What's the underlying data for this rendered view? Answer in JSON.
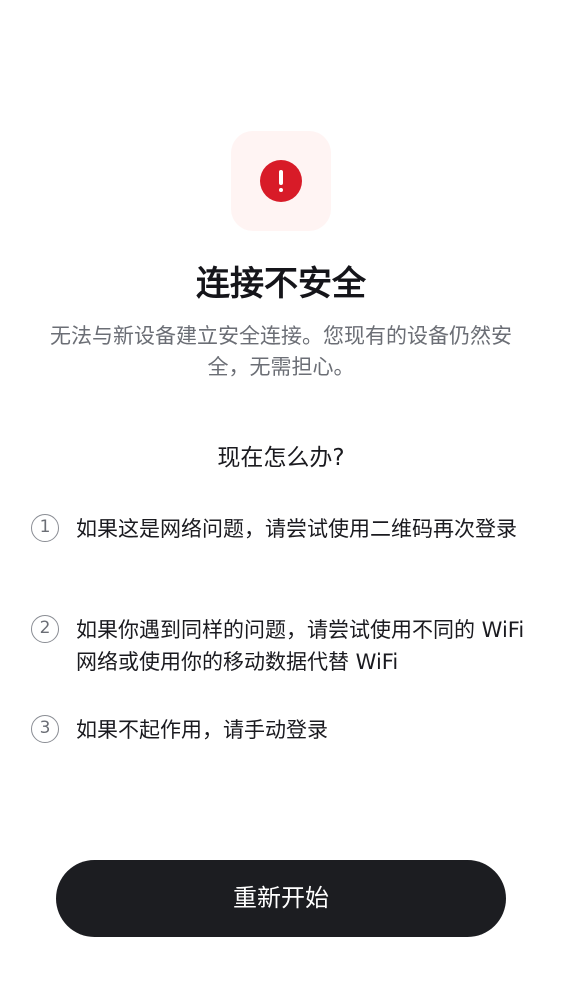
{
  "status_icon": {
    "name": "alert-icon",
    "glyph": "!",
    "color": "#d81b28",
    "tile_color": "#fff4f3"
  },
  "header": {
    "title": "连接不安全",
    "subtitle": "无法与新设备建立安全连接。您现有的设备仍然安全，无需担心。"
  },
  "next_steps": {
    "heading": "现在怎么办?",
    "items": [
      {
        "number": "1",
        "text": "如果这是网络问题，请尝试使用二维码再次登录"
      },
      {
        "number": "2",
        "text": "如果你遇到同样的问题，请尝试使用不同的 WiFi 网络或使用你的移动数据代替 WiFi"
      },
      {
        "number": "3",
        "text": "如果不起作用，请手动登录"
      }
    ]
  },
  "actions": {
    "restart_label": "重新开始"
  }
}
